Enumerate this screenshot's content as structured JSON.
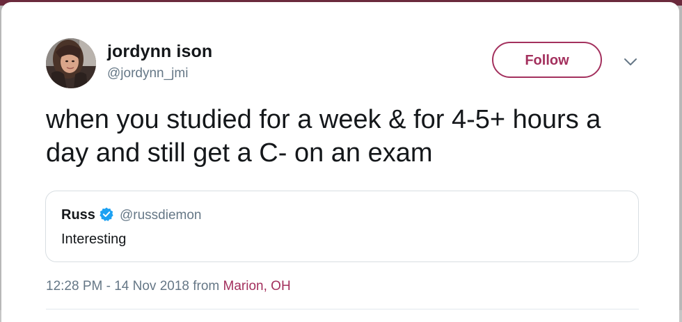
{
  "author": {
    "display_name": "jordynn ison",
    "handle": "@jordynn_jmi",
    "avatar_icon": "avatar-photo"
  },
  "follow_button": {
    "label": "Follow",
    "accent_color": "#a3305d"
  },
  "menu": {
    "icon": "chevron-down-icon"
  },
  "tweet": {
    "text": "when you studied for a week & for 4-5+ hours a day and still get a C- on an exam"
  },
  "quoted_tweet": {
    "display_name": "Russ",
    "verified_icon": "verified-badge-icon",
    "verified_color": "#1da1f2",
    "handle": "@russdiemon",
    "text": "Interesting"
  },
  "meta": {
    "timestamp": "12:28 PM - 14 Nov 2018",
    "from_label": "from",
    "location": "Marion, OH"
  },
  "colors": {
    "text_primary": "#14171a",
    "text_secondary": "#657786",
    "border": "#d8dee2"
  }
}
